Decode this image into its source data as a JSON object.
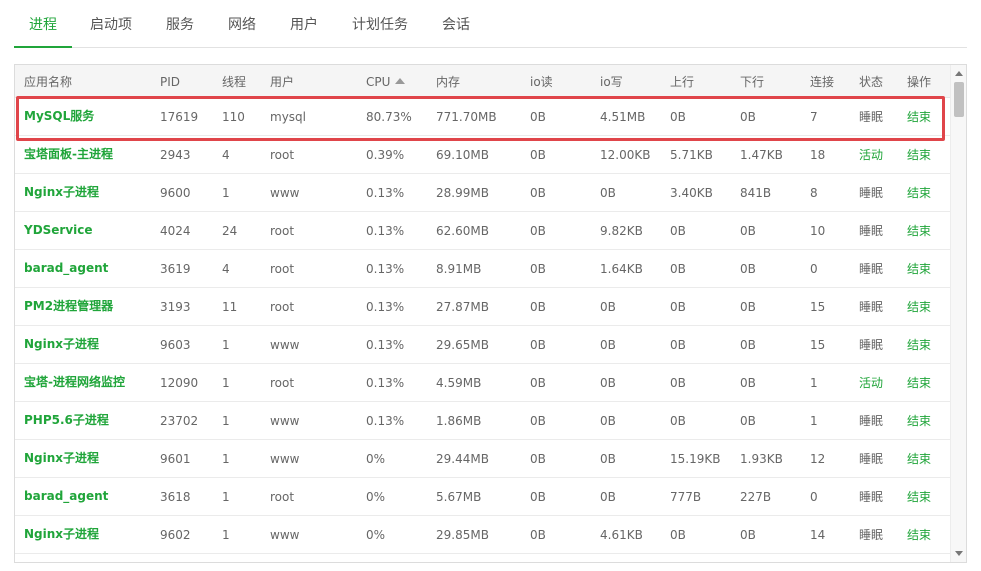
{
  "tabs": [
    {
      "label": "进程",
      "active": true
    },
    {
      "label": "启动项",
      "active": false
    },
    {
      "label": "服务",
      "active": false
    },
    {
      "label": "网络",
      "active": false
    },
    {
      "label": "用户",
      "active": false
    },
    {
      "label": "计划任务",
      "active": false
    },
    {
      "label": "会话",
      "active": false
    }
  ],
  "table": {
    "columns": {
      "name": "应用名称",
      "pid": "PID",
      "threads": "线程",
      "user": "用户",
      "cpu": "CPU",
      "memory": "内存",
      "io_read": "io读",
      "io_write": "io写",
      "upload": "上行",
      "download": "下行",
      "connections": "连接",
      "status": "状态",
      "action": "操作"
    },
    "sort": {
      "column": "cpu",
      "direction": "descending-indicator-up"
    },
    "rows": [
      {
        "name": "MySQL服务",
        "pid": "17619",
        "threads": "110",
        "user": "mysql",
        "cpu": "80.73%",
        "memory": "771.70MB",
        "io_read": "0B",
        "io_write": "4.51MB",
        "upload": "0B",
        "download": "0B",
        "connections": "7",
        "status": "睡眠",
        "status_active": false,
        "action": "结束",
        "highlighted": true
      },
      {
        "name": "宝塔面板-主进程",
        "pid": "2943",
        "threads": "4",
        "user": "root",
        "cpu": "0.39%",
        "memory": "69.10MB",
        "io_read": "0B",
        "io_write": "12.00KB",
        "upload": "5.71KB",
        "download": "1.47KB",
        "connections": "18",
        "status": "活动",
        "status_active": true,
        "action": "结束"
      },
      {
        "name": "Nginx子进程",
        "pid": "9600",
        "threads": "1",
        "user": "www",
        "cpu": "0.13%",
        "memory": "28.99MB",
        "io_read": "0B",
        "io_write": "0B",
        "upload": "3.40KB",
        "download": "841B",
        "connections": "8",
        "status": "睡眠",
        "status_active": false,
        "action": "结束"
      },
      {
        "name": "YDService",
        "pid": "4024",
        "threads": "24",
        "user": "root",
        "cpu": "0.13%",
        "memory": "62.60MB",
        "io_read": "0B",
        "io_write": "9.82KB",
        "upload": "0B",
        "download": "0B",
        "connections": "10",
        "status": "睡眠",
        "status_active": false,
        "action": "结束"
      },
      {
        "name": "barad_agent",
        "pid": "3619",
        "threads": "4",
        "user": "root",
        "cpu": "0.13%",
        "memory": "8.91MB",
        "io_read": "0B",
        "io_write": "1.64KB",
        "upload": "0B",
        "download": "0B",
        "connections": "0",
        "status": "睡眠",
        "status_active": false,
        "action": "结束"
      },
      {
        "name": "PM2进程管理器",
        "pid": "3193",
        "threads": "11",
        "user": "root",
        "cpu": "0.13%",
        "memory": "27.87MB",
        "io_read": "0B",
        "io_write": "0B",
        "upload": "0B",
        "download": "0B",
        "connections": "15",
        "status": "睡眠",
        "status_active": false,
        "action": "结束"
      },
      {
        "name": "Nginx子进程",
        "pid": "9603",
        "threads": "1",
        "user": "www",
        "cpu": "0.13%",
        "memory": "29.65MB",
        "io_read": "0B",
        "io_write": "0B",
        "upload": "0B",
        "download": "0B",
        "connections": "15",
        "status": "睡眠",
        "status_active": false,
        "action": "结束"
      },
      {
        "name": "宝塔-进程网络监控",
        "pid": "12090",
        "threads": "1",
        "user": "root",
        "cpu": "0.13%",
        "memory": "4.59MB",
        "io_read": "0B",
        "io_write": "0B",
        "upload": "0B",
        "download": "0B",
        "connections": "1",
        "status": "活动",
        "status_active": true,
        "action": "结束"
      },
      {
        "name": "PHP5.6子进程",
        "pid": "23702",
        "threads": "1",
        "user": "www",
        "cpu": "0.13%",
        "memory": "1.86MB",
        "io_read": "0B",
        "io_write": "0B",
        "upload": "0B",
        "download": "0B",
        "connections": "1",
        "status": "睡眠",
        "status_active": false,
        "action": "结束"
      },
      {
        "name": "Nginx子进程",
        "pid": "9601",
        "threads": "1",
        "user": "www",
        "cpu": "0%",
        "memory": "29.44MB",
        "io_read": "0B",
        "io_write": "0B",
        "upload": "15.19KB",
        "download": "1.93KB",
        "connections": "12",
        "status": "睡眠",
        "status_active": false,
        "action": "结束"
      },
      {
        "name": "barad_agent",
        "pid": "3618",
        "threads": "1",
        "user": "root",
        "cpu": "0%",
        "memory": "5.67MB",
        "io_read": "0B",
        "io_write": "0B",
        "upload": "777B",
        "download": "227B",
        "connections": "0",
        "status": "睡眠",
        "status_active": false,
        "action": "结束"
      },
      {
        "name": "Nginx子进程",
        "pid": "9602",
        "threads": "1",
        "user": "www",
        "cpu": "0%",
        "memory": "29.85MB",
        "io_read": "0B",
        "io_write": "4.61KB",
        "upload": "0B",
        "download": "0B",
        "connections": "14",
        "status": "睡眠",
        "status_active": false,
        "action": "结束"
      }
    ]
  },
  "colors": {
    "accent": "#20a53a",
    "highlight_border": "#e0454a",
    "header_bg": "#f5f5f5",
    "text": "#666666"
  },
  "icons": {
    "sort": "sort-ascending-triangle-icon",
    "scroll_up": "scroll-up-arrow-icon",
    "scroll_down": "scroll-down-arrow-icon"
  }
}
